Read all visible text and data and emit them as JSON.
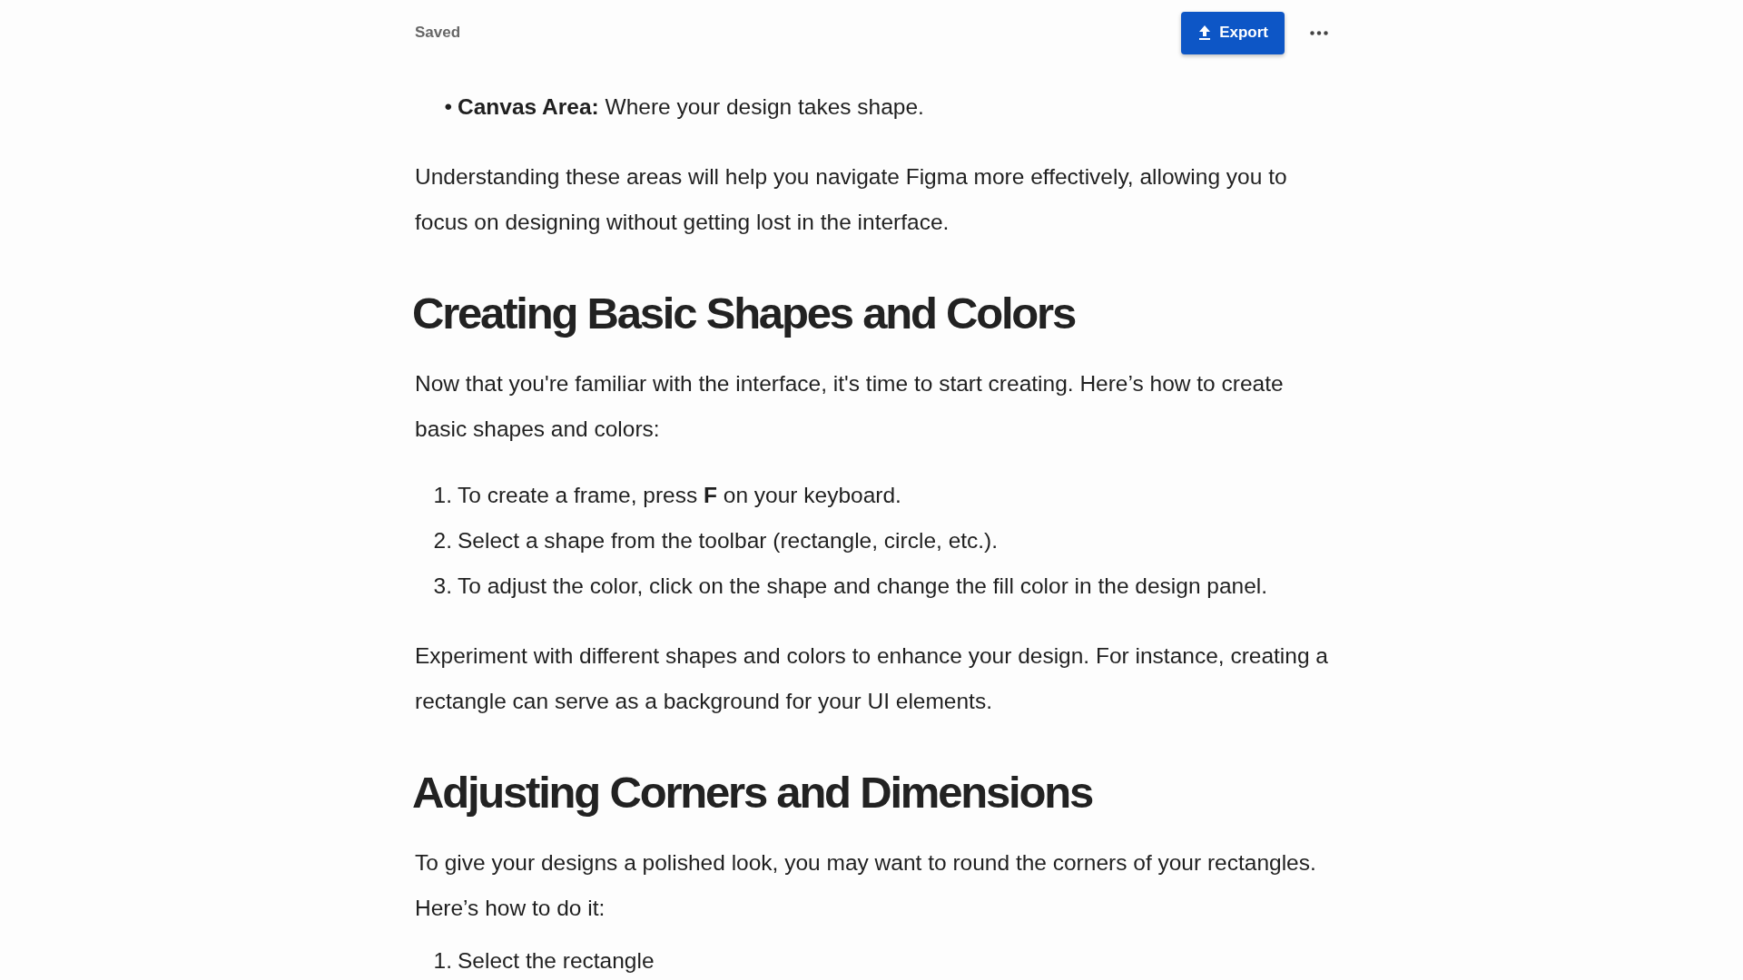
{
  "header": {
    "status": "Saved",
    "export_label": "Export"
  },
  "blocks": [
    {
      "kind": "bullet_list",
      "items": [
        {
          "marker": "•",
          "text": "**Canvas Area:** Where your design takes shape."
        }
      ]
    },
    {
      "kind": "paragraph",
      "text": "Understanding these areas will help you navigate Figma more effectively, allowing you to focus on designing without getting lost in the interface."
    },
    {
      "kind": "heading",
      "text": "Creating Basic Shapes and Colors"
    },
    {
      "kind": "paragraph",
      "text": "Now that you're familiar with the interface, it's time to start creating. Here’s how to create basic shapes and colors:"
    },
    {
      "kind": "ordered_list",
      "items": [
        {
          "marker": "1.",
          "text": "To create a frame, press **F** on your keyboard."
        },
        {
          "marker": "2.",
          "text": "Select a shape from the toolbar (rectangle, circle, etc.)."
        },
        {
          "marker": "3.",
          "text": "To adjust the color, click on the shape and change the fill color in the design panel."
        }
      ]
    },
    {
      "kind": "paragraph",
      "text": "Experiment with different shapes and colors to enhance your design. For instance, creating a rectangle can serve as a background for your UI elements."
    },
    {
      "kind": "heading",
      "text": "Adjusting Corners and Dimensions"
    },
    {
      "kind": "paragraph",
      "text": "To give your designs a polished look, you may want to round the corners of your rectangles. Here’s how to do it:"
    },
    {
      "kind": "ordered_list",
      "items": [
        {
          "marker": "1.",
          "text": "Select the rectangle"
        }
      ]
    }
  ]
}
